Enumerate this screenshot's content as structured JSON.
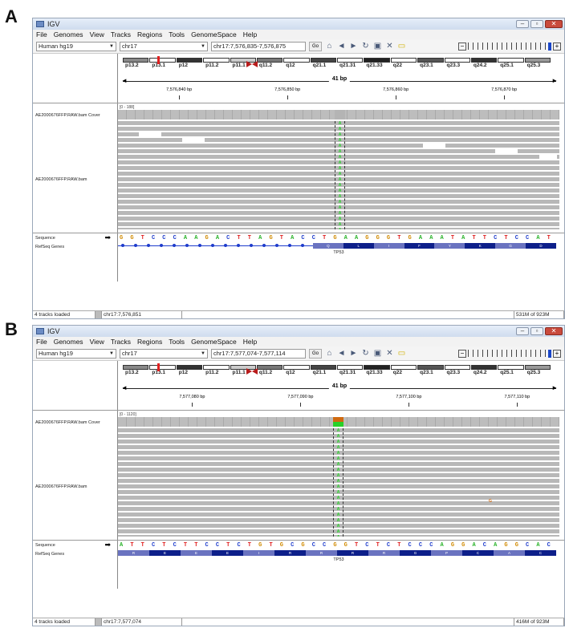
{
  "panels": [
    {
      "letter": "A",
      "window_title": "IGV",
      "menu": [
        "File",
        "Genomes",
        "View",
        "Tracks",
        "Regions",
        "Tools",
        "GenomeSpace",
        "Help"
      ],
      "genome": "Human hg19",
      "chromosome": "chr17",
      "locus": "chr17:7,576,835-7,576,875",
      "go_label": "Go",
      "cytobands": [
        "p13.2",
        "p13.1",
        "p12",
        "p11.2",
        "p11.1",
        "q11.2",
        "q12",
        "q21.1",
        "q21.31",
        "q21.33",
        "q22",
        "q23.1",
        "q23.3",
        "q24.2",
        "q25.1",
        "q25.3"
      ],
      "span": "41 bp",
      "ruler_ticks": [
        "7,576,840 bp",
        "7,576,850 bp",
        "7,576,860 bp",
        "7,576,870 bp"
      ],
      "coverage_track": "AE2000676FFP.RAW.bam Cover",
      "coverage_scale": "[0 - 188]",
      "alignment_track": "AE2000676FFP.RAW.bam",
      "snp_base": "A",
      "sequence_label": "Sequence",
      "sequence": "GGTCCCAAGACTTAGTACCTGAAGGGTGAAATATTCTCCAT",
      "genes_label": "RefSeq Genes",
      "amino_acids": [
        "Q",
        "L",
        "I",
        "F",
        "Y",
        "K",
        "G",
        "D"
      ],
      "gene_name": "TP53",
      "status_tracks": "4 tracks loaded",
      "status_pos": "chr17:7,576,851",
      "status_mem": "531M of 923M"
    },
    {
      "letter": "B",
      "window_title": "IGV",
      "menu": [
        "File",
        "Genomes",
        "View",
        "Tracks",
        "Regions",
        "Tools",
        "GenomeSpace",
        "Help"
      ],
      "genome": "Human hg19",
      "chromosome": "chr17",
      "locus": "chr17:7,577,074-7,577,114",
      "go_label": "Go",
      "cytobands": [
        "p13.2",
        "p13.1",
        "p12",
        "p11.2",
        "p11.1",
        "q11.2",
        "q12",
        "q21.1",
        "q21.31",
        "q21.33",
        "q22",
        "q23.1",
        "q23.3",
        "q24.2",
        "q25.1",
        "q25.3"
      ],
      "span": "41 bp",
      "ruler_ticks": [
        "7,577,080 bp",
        "7,577,090 bp",
        "7,577,100 bp",
        "7,577,110 bp"
      ],
      "coverage_track": "AE2000676FFP.RAW.bam Cover",
      "coverage_scale": "[0 - 1120]",
      "alignment_track": "AE2000676FFP.RAW.bam",
      "snp_base": "A",
      "sequence_label": "Sequence",
      "sequence": "ATTCTCTTCCTCTGTGCGCCGGTCTCTCCCAGGACAGGCAC",
      "genes_label": "RefSeq Genes",
      "amino_acids": [
        "R",
        "E",
        "E",
        "E",
        "I",
        "R",
        "R",
        "R",
        "R",
        "G",
        "P",
        "C",
        "A",
        "C"
      ],
      "gene_name": "TP53",
      "status_tracks": "4 tracks loaded",
      "status_pos": "chr17:7,577,074",
      "status_mem": "416M of 923M"
    }
  ],
  "colors": {
    "A": "#2fb52f",
    "C": "#1e3ccc",
    "G": "#d18a00",
    "T": "#e02020",
    "aa_dark": "#0d1f8a",
    "aa_light": "#6a73c0",
    "snp_green": "#28d028",
    "snp_orange": "#d06a10"
  },
  "icons": [
    "home-icon",
    "back-icon",
    "forward-icon",
    "refresh-icon",
    "roi-icon",
    "close-icon",
    "popup-icon"
  ]
}
